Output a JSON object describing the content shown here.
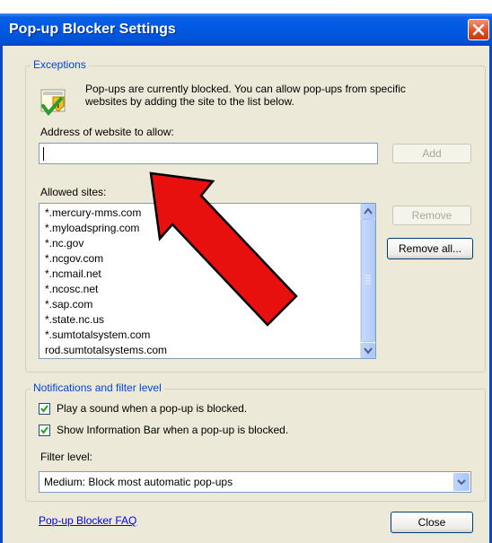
{
  "window": {
    "title": "Pop-up Blocker Settings"
  },
  "exceptions": {
    "legend": "Exceptions",
    "info_line1": "Pop-ups are currently blocked.  You can allow pop-ups from specific",
    "info_line2": "websites by adding the site to the list below.",
    "address_label": "Address of website to allow:",
    "address_value": "",
    "add_label": "Add",
    "allowed_label": "Allowed sites:",
    "allowed_sites": [
      "*.mercury-mms.com",
      "*.myloadspring.com",
      "*.nc.gov",
      "*.ncgov.com",
      "*.ncmail.net",
      "*.ncosc.net",
      "*.sap.com",
      "*.state.nc.us",
      "*.sumtotalsystem.com",
      "rod.sumtotalsystems.com"
    ],
    "remove_label": "Remove",
    "remove_all_label": "Remove all..."
  },
  "notifications": {
    "legend": "Notifications and filter level",
    "play_sound": {
      "label": "Play a sound when a pop-up is blocked.",
      "checked": true
    },
    "info_bar": {
      "label": "Show Information Bar when a pop-up is blocked.",
      "checked": true
    },
    "filter_label": "Filter level:",
    "filter_value": "Medium: Block most automatic pop-ups"
  },
  "footer": {
    "faq_link": "Pop-up Blocker FAQ",
    "close_label": "Close"
  },
  "colors": {
    "titlebar": "#0058e1",
    "legend": "#0046d5",
    "arrow": "#e8100f",
    "dialog_bg": "#ece9d8"
  },
  "icons": [
    "warning-shield-icon",
    "close-icon",
    "scroll-up-arrow-icon",
    "scroll-down-arrow-icon",
    "dropdown-arrow-icon",
    "checkmark-icon",
    "red-arrow-annotation"
  ]
}
